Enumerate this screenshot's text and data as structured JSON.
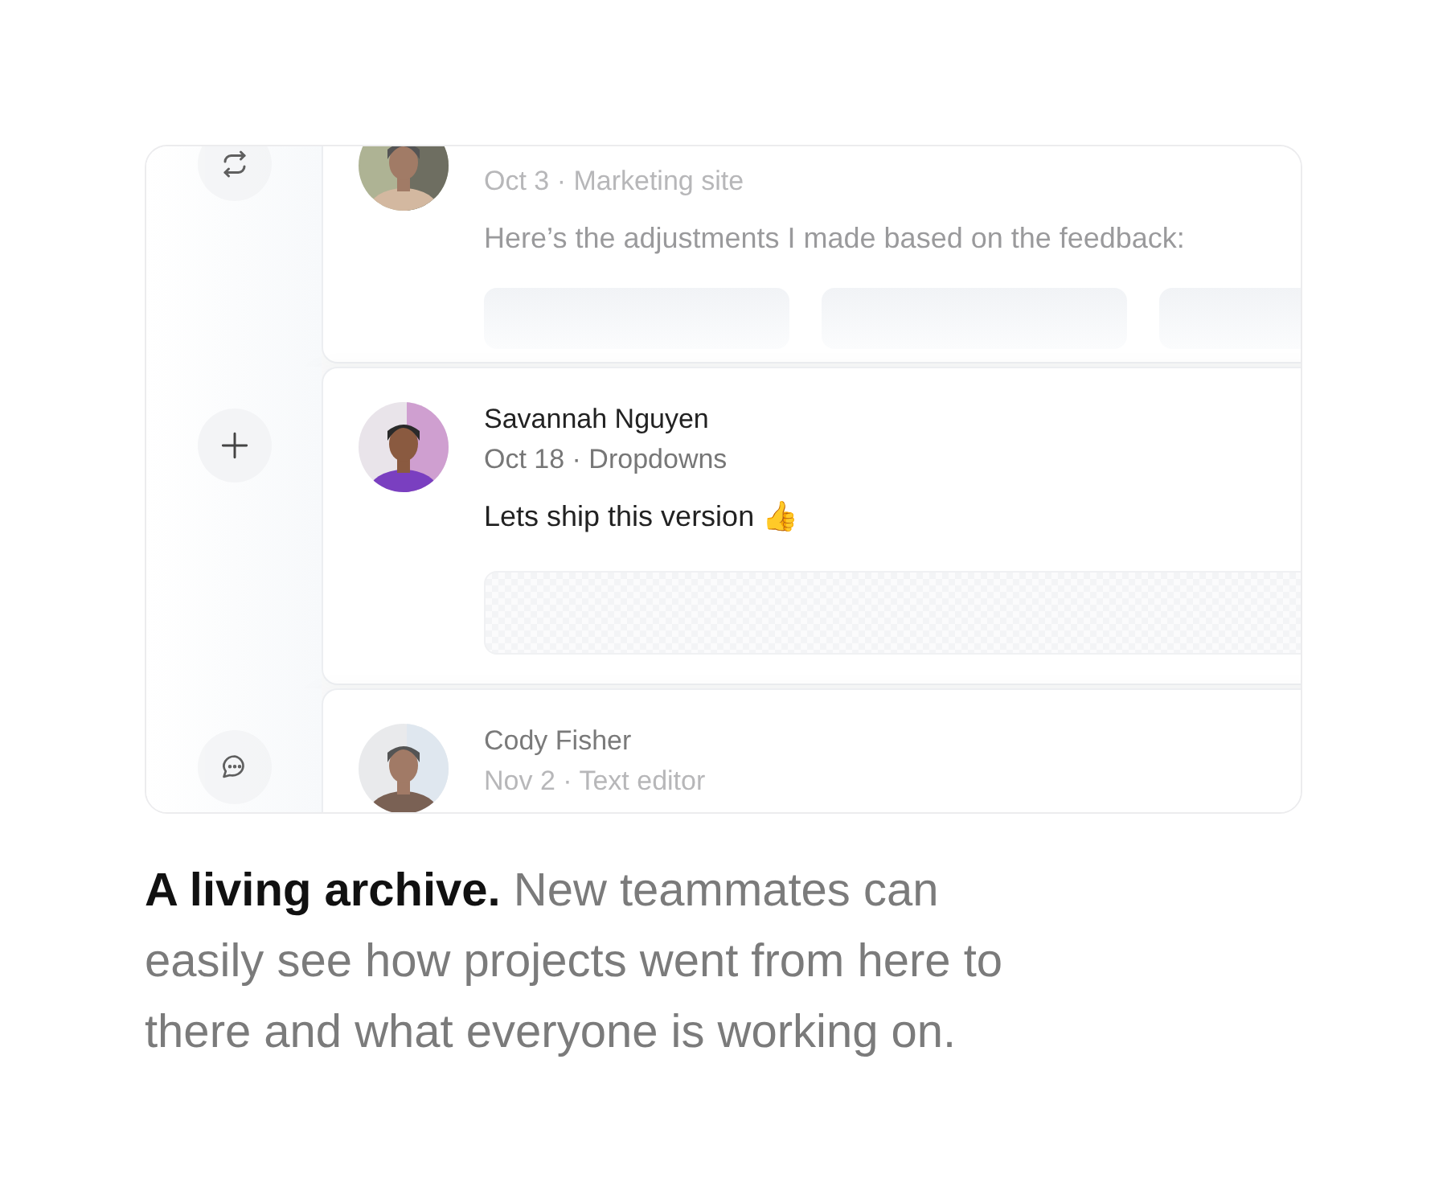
{
  "timeline": [
    {
      "kind": "sync",
      "dimmed": true,
      "meta": "Oct 3 · Marketing site",
      "body": "Here’s the adjustments I made based on the feedback:",
      "attachment": {
        "kind": "tiles"
      }
    },
    {
      "kind": "add",
      "dimmed": false,
      "name": "Savannah Nguyen",
      "meta": "Oct 18 · Dropdowns",
      "body": "Lets ship this version 👍",
      "attachment": {
        "kind": "pattern"
      }
    },
    {
      "kind": "comment",
      "dimmed": true,
      "name": "Cody Fisher",
      "meta": "Nov 2 · Text editor"
    }
  ],
  "caption": "**A living archive.** New teammates can easily see how projects went from here to there and what everyone is working on."
}
